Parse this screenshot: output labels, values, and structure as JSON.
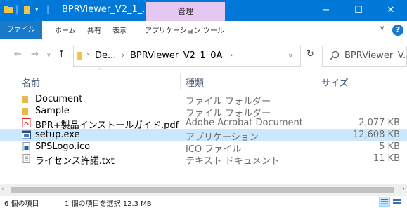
{
  "titlebar": {
    "title": "BPRViewer_V2_1_...",
    "context_tab": "管理",
    "minimize": "−",
    "maximize": "☐",
    "close": "✕",
    "accent": "#0078d7"
  },
  "ribbon": {
    "tabs": [
      "ファイル",
      "ホーム",
      "共有",
      "表示",
      "アプリケーション ツール"
    ],
    "expand": "∨",
    "help": "?"
  },
  "address": {
    "back": "←",
    "forward": "→",
    "up": "↑",
    "crumbs": [
      "De...",
      "BPRViewer_V2_1_0A"
    ],
    "dropdown": "∨",
    "refresh": "↻",
    "search_placeholder": "BPRViewer_V..."
  },
  "columns": {
    "name": "名前",
    "type": "種類",
    "size": "サイズ"
  },
  "files": [
    {
      "name": "Document",
      "type": "ファイル フォルダー",
      "size": "",
      "icon": "folder-icon",
      "selected": false
    },
    {
      "name": "Sample",
      "type": "ファイル フォルダー",
      "size": "",
      "icon": "folder-icon",
      "selected": false
    },
    {
      "name": "BPR+製品インストールガイド.pdf",
      "type": "Adobe Acrobat Document",
      "size": "2,077 KB",
      "icon": "pdf-icon",
      "selected": false
    },
    {
      "name": "setup.exe",
      "type": "アプリケーション",
      "size": "12,608 KB",
      "icon": "exe-icon",
      "selected": true
    },
    {
      "name": "SPSLogo.ico",
      "type": "ICO ファイル",
      "size": "5 KB",
      "icon": "ico-file-icon",
      "selected": false
    },
    {
      "name": "ライセンス許諾.txt",
      "type": "テキスト ドキュメント",
      "size": "11 KB",
      "icon": "text-file-icon",
      "selected": false
    }
  ],
  "status": {
    "count": "6 個の項目",
    "selection": "1 個の項目を選択  12.3 MB"
  },
  "colors": {
    "selection": "#cce8ff",
    "folder": "#e8b84a",
    "pdf": "#d9252a",
    "context_tab": "#e6c7f2"
  }
}
